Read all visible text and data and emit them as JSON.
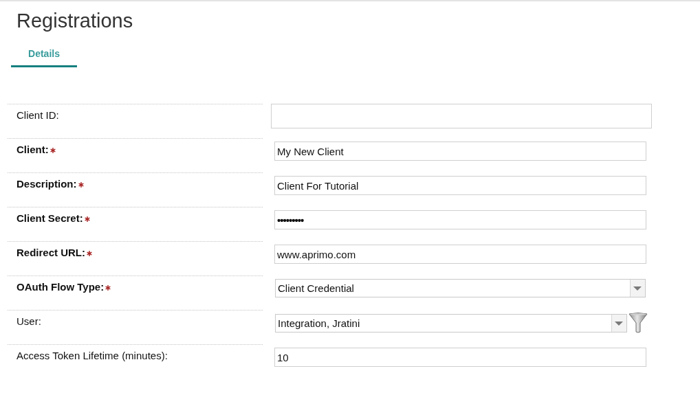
{
  "page": {
    "title": "Registrations"
  },
  "tabs": [
    {
      "label": "Details",
      "selected": true
    }
  ],
  "form": {
    "fields": [
      {
        "label": "Client ID:",
        "required": false,
        "kind": "display"
      },
      {
        "label": "Client:",
        "required": true,
        "kind": "text",
        "value": "My New Client"
      },
      {
        "label": "Description:",
        "required": true,
        "kind": "text",
        "value": "Client For Tutorial"
      },
      {
        "label": "Client Secret:",
        "required": true,
        "kind": "password",
        "value": "•••••••••"
      },
      {
        "label": "Redirect URL:",
        "required": true,
        "kind": "text",
        "value": "www.aprimo.com"
      },
      {
        "label": "OAuth Flow Type:",
        "required": true,
        "kind": "select",
        "value": "Client Credential"
      },
      {
        "label": "User:",
        "required": false,
        "kind": "lookup",
        "value": "Integration, Jratini"
      },
      {
        "label": "Access Token Lifetime (minutes):",
        "required": false,
        "kind": "text",
        "value": "10"
      }
    ]
  }
}
